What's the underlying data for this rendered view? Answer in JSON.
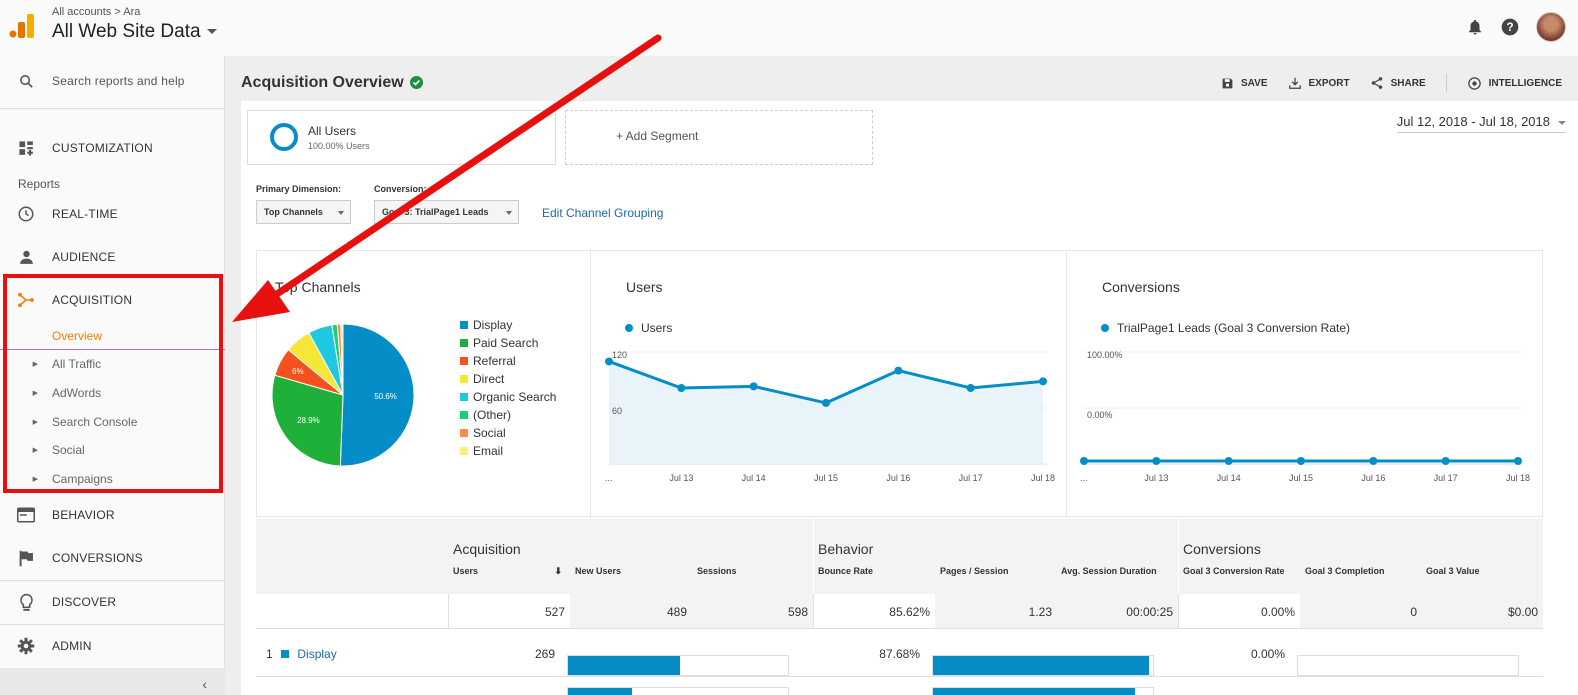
{
  "header": {
    "breadcrumb": "All accounts > Ara",
    "property_name": "All Web Site Data",
    "icons": [
      "bell-icon",
      "help-icon",
      "avatar"
    ]
  },
  "sidebar": {
    "search_placeholder": "Search reports and help",
    "customization": "CUSTOMIZATION",
    "reports_header": "Reports",
    "realtime": "REAL-TIME",
    "audience": "AUDIENCE",
    "acquisition": "ACQUISITION",
    "overview": "Overview",
    "sub_items": [
      "All Traffic",
      "AdWords",
      "Search Console",
      "Social",
      "Campaigns"
    ],
    "behavior": "BEHAVIOR",
    "conversions": "CONVERSIONS",
    "discover": "DISCOVER",
    "admin": "ADMIN",
    "collapse_glyph": "‹",
    "accent_color": "#f57c00"
  },
  "main": {
    "title": "Acquisition Overview",
    "actions": {
      "save": "SAVE",
      "export": "EXPORT",
      "share": "SHARE",
      "intelligence": "INTELLIGENCE"
    },
    "segment": {
      "name": "All Users",
      "pct": "100.00% Users",
      "add": "+ Add Segment"
    },
    "date_range": "Jul 12, 2018 - Jul 18, 2018",
    "primary_dimension_label": "Primary Dimension:",
    "primary_dimension_value": "Top Channels",
    "conversion_label": "Conversion:",
    "conversion_value": "Goal 3: TrialPage1 Leads",
    "edit_link": "Edit Channel Grouping"
  },
  "chart_data": [
    {
      "type": "pie",
      "title": "Top Channels",
      "categories": [
        "Display",
        "Paid Search",
        "Referral",
        "Direct",
        "Organic Search",
        "(Other)",
        "Social",
        "Email"
      ],
      "values": [
        50.6,
        28.9,
        6.5,
        6,
        5.5,
        1.2,
        0.8,
        0.5
      ],
      "labels_shown": [
        "50.6%",
        "28.9%",
        "6%"
      ],
      "colors": [
        "#058dc7",
        "#1fb03a",
        "#f4511e",
        "#f5e637",
        "#1ec8e1",
        "#14d27a",
        "#ff8a50",
        "#fff176"
      ],
      "legend": "right"
    },
    {
      "type": "area",
      "title": "Users",
      "series": [
        {
          "name": "Users",
          "values": [
            120,
            88,
            90,
            70,
            109,
            88,
            96
          ]
        }
      ],
      "x": [
        "Jul 12",
        "Jul 13",
        "Jul 14",
        "Jul 15",
        "Jul 16",
        "Jul 17",
        "Jul 18"
      ],
      "x_tick_labels": [
        "...",
        "Jul 13",
        "Jul 14",
        "Jul 15",
        "Jul 16",
        "Jul 17",
        "Jul 18"
      ],
      "y_ticks": [
        "120",
        "60"
      ],
      "ylim": [
        0,
        135
      ],
      "grid": true
    },
    {
      "type": "line",
      "title": "Conversions",
      "series": [
        {
          "name": "TrialPage1 Leads (Goal 3 Conversion Rate)",
          "values": [
            0,
            0,
            0,
            0,
            0,
            0,
            0
          ]
        }
      ],
      "x": [
        "Jul 12",
        "Jul 13",
        "Jul 14",
        "Jul 15",
        "Jul 16",
        "Jul 17",
        "Jul 18"
      ],
      "x_tick_labels": [
        "...",
        "Jul 13",
        "Jul 14",
        "Jul 15",
        "Jul 16",
        "Jul 17",
        "Jul 18"
      ],
      "y_ticks": [
        "100.00%",
        "0.00%"
      ],
      "ylim": [
        0,
        100
      ],
      "grid": true
    }
  ],
  "table": {
    "groups": [
      "Acquisition",
      "Behavior",
      "Conversions"
    ],
    "columns": [
      "Users",
      "New Users",
      "Sessions",
      "Bounce Rate",
      "Pages / Session",
      "Avg. Session Duration",
      "Goal 3 Conversion Rate",
      "Goal 3 Completion",
      "Goal 3 Value"
    ],
    "totals": [
      "527",
      "489",
      "598",
      "85.62%",
      "1.23",
      "00:00:25",
      "0.00%",
      "0",
      "$0.00"
    ],
    "rows": [
      {
        "index": "1",
        "channel": "Display",
        "users": "269",
        "new_users_share": 0.51,
        "bounce_rate": "87.68%",
        "pages_share": 0.98,
        "conv_rate": "0.00%"
      }
    ],
    "row2_bars": {
      "new_users_share": 0.29,
      "pages_share": 0.92
    }
  }
}
